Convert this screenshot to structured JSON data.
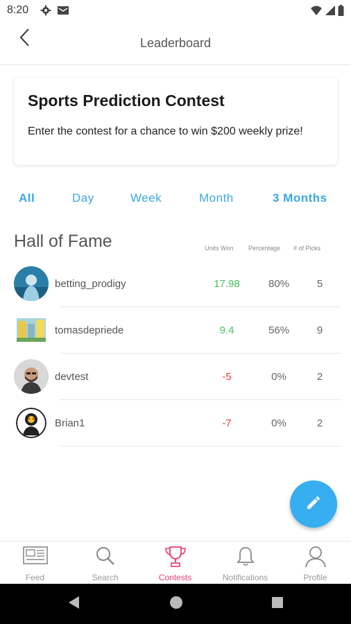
{
  "status_bar": {
    "time": "8:20",
    "left_icons": [
      "gear-icon",
      "mail-icon"
    ],
    "right_icons": [
      "wifi-icon",
      "signal-icon",
      "battery-icon"
    ]
  },
  "header": {
    "title": "Leaderboard",
    "back_icon": "chevron-left-icon"
  },
  "contest_card": {
    "title": "Sports Prediction Contest",
    "description": "Enter the contest for a chance to win $200 weekly prize!"
  },
  "period_tabs": [
    {
      "label": "All",
      "bold": true
    },
    {
      "label": "Day",
      "bold": false
    },
    {
      "label": "Week",
      "bold": false
    },
    {
      "label": "Month",
      "bold": false
    },
    {
      "label": "3 Months",
      "bold": true
    }
  ],
  "hall_of_fame": {
    "title": "Hall of Fame",
    "columns": {
      "units_won": "Units Won",
      "percentage": "Percentage",
      "picks": "# of Picks"
    },
    "rows": [
      {
        "username": "betting_prodigy",
        "units_won": "17.98",
        "percentage": "80%",
        "picks": "5",
        "avatar": "avatar-photo-person-light"
      },
      {
        "username": "tomasdepriede",
        "units_won": "9.4",
        "percentage": "56%",
        "picks": "9",
        "avatar": "avatar-photo-buildings"
      },
      {
        "username": "devtest",
        "units_won": "-5",
        "percentage": "0%",
        "picks": "2",
        "avatar": "avatar-photo-bearded-man"
      },
      {
        "username": "Brian1",
        "units_won": "-7",
        "percentage": "0%",
        "picks": "2",
        "avatar": "avatar-cartoon"
      }
    ]
  },
  "fab": {
    "icon": "pencil-icon"
  },
  "bottom_nav": [
    {
      "label": "Feed",
      "icon": "newspaper-icon",
      "active": false
    },
    {
      "label": "Search",
      "icon": "search-icon",
      "active": false
    },
    {
      "label": "Contests",
      "icon": "trophy-icon",
      "active": true
    },
    {
      "label": "Notifications",
      "icon": "bell-icon",
      "active": false
    },
    {
      "label": "Profile",
      "icon": "person-icon",
      "active": false
    }
  ],
  "colors": {
    "accent_blue": "#3ba7e3",
    "fab_blue": "#36aef0",
    "positive_green": "#41c45b",
    "negative_red": "#e8443a",
    "active_pink": "#e33a72"
  }
}
